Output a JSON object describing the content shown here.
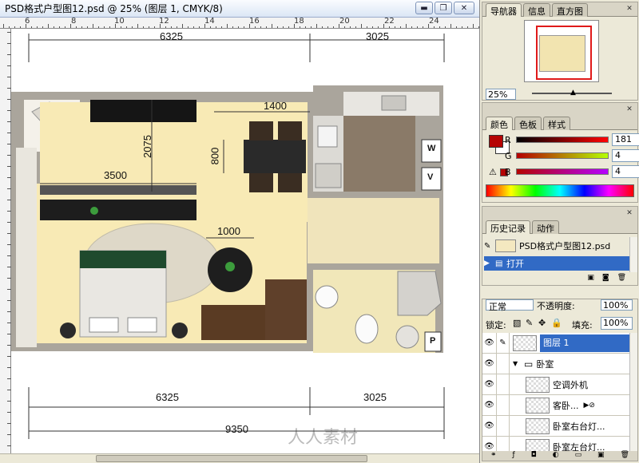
{
  "document": {
    "title": "PSD格式户型图12.psd @ 25% (图层 1, CMYK/8)",
    "ruler_numbers": [
      "6",
      "8",
      "10",
      "12",
      "14",
      "16",
      "18",
      "20",
      "22",
      "24"
    ],
    "window_buttons": {
      "minimize": "▬",
      "restore": "❐",
      "close": "✕"
    }
  },
  "floorplan": {
    "dims": {
      "top_left": "6325",
      "top_right": "3025",
      "dining_width": "1400",
      "bedroom_height": "2075",
      "dining_height": "800",
      "left_room_width": "3500",
      "table_width": "1000",
      "bottom_left": "6325",
      "bottom_right": "3025",
      "total": "9350"
    },
    "wall_color": "#a9a49b",
    "floor_color": "#f8eab5",
    "tile_color": "#8c7c6a",
    "door_labels": [
      "W",
      "V",
      "P"
    ],
    "watermark": "人人素材"
  },
  "navigator": {
    "tabs": [
      "导航器",
      "信息",
      "直方图"
    ],
    "zoom": "25%"
  },
  "color": {
    "tabs": [
      "颜色",
      "色板",
      "样式"
    ],
    "r_label": "R",
    "g_label": "G",
    "b_label": "B",
    "r": "181",
    "g": "4",
    "b": "4",
    "fg": "#b50404",
    "bg": "#ffffff"
  },
  "history": {
    "tabs": [
      "历史记录",
      "动作"
    ],
    "snapshot": "PSD格式户型图12.psd",
    "step": "打开"
  },
  "layers": {
    "blend_mode": "正常",
    "opacity_label": "不透明度:",
    "opacity": "100%",
    "lock_label": "锁定:",
    "fill_label": "填充:",
    "fill": "100%",
    "items": [
      {
        "name": "图层 1",
        "selected": true,
        "indent": 0
      },
      {
        "name": "卧室",
        "folder": true,
        "indent": 0
      },
      {
        "name": "空调外机",
        "indent": 1
      },
      {
        "name": "客卧...",
        "indent": 1,
        "fx": true
      },
      {
        "name": "卧室右台灯...",
        "indent": 1
      },
      {
        "name": "卧室左台灯...",
        "indent": 1
      }
    ]
  }
}
